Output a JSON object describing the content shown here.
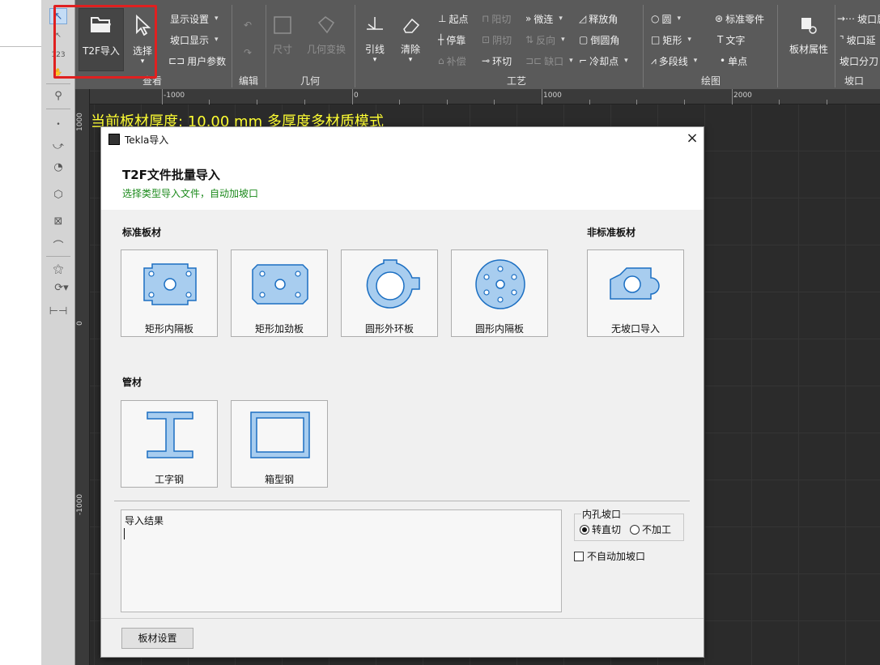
{
  "ribbon": {
    "groups": {
      "view": "查看",
      "edit": "编辑",
      "geometry": "几何",
      "process": "工艺",
      "draw": "绘图",
      "bevel": "坡口"
    },
    "t2f_import": "T2F导入",
    "select": "选择",
    "display_settings": "显示设置",
    "bevel_display": "坡口显示",
    "user_params": "用户参数",
    "dimension": "尺寸",
    "geo_transform": "几何变换",
    "lead": "引线",
    "clear": "清除",
    "start_point": "起点",
    "positive_cut": "阳切",
    "micro_joint": "微连",
    "release_corner": "释放角",
    "stop_point": "停靠",
    "negative_cut": "阴切",
    "reverse": "反向",
    "fillet": "倒圆角",
    "compensate": "补偿",
    "ring_cut": "环切",
    "gap": "缺口",
    "cooling_point": "冷却点",
    "circle": "圆",
    "rectangle": "矩形",
    "polyline": "多段线",
    "std_part": "标准零件",
    "text": "文字",
    "single_point": "单点",
    "plate_props": "板材属性",
    "bevel_edge": "坡口属",
    "bevel_extend": "坡口延",
    "bevel_split": "坡口分刀"
  },
  "canvas": {
    "thickness_text": "当前板材厚度: 10.00 mm 多厚度多材质模式",
    "ruler_top": [
      "-1000",
      "0",
      "1000",
      "2000"
    ],
    "ruler_left": [
      "1000",
      "0",
      "-1000"
    ]
  },
  "dialog": {
    "title": "Tekla导入",
    "close": "×",
    "heading": "T2F文件批量导入",
    "subtitle": "选择类型导入文件，自动加坡口",
    "standard_title": "标准板材",
    "nonstandard_title": "非标准板材",
    "pipe_title": "管材",
    "cards": {
      "rect_inner": "矩形内隔板",
      "rect_stiff": "矩形加劲板",
      "round_outer": "圆形外环板",
      "round_inner": "圆形内隔板",
      "no_bevel": "无坡口导入",
      "i_beam": "工字钢",
      "box_beam": "箱型钢"
    },
    "result_label": "导入结果",
    "hole_bevel_label": "内孔坡口",
    "radio_straight": "转直切",
    "radio_none": "不加工",
    "no_auto_bevel": "不自动加坡口",
    "plate_settings": "板材设置"
  }
}
